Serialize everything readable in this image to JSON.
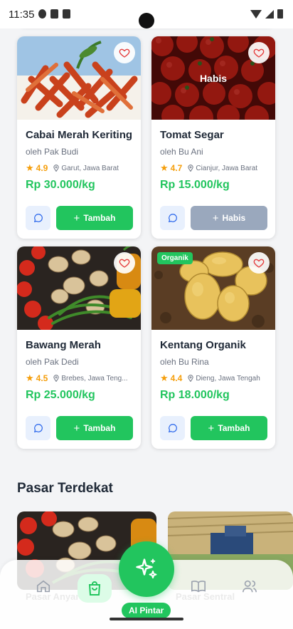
{
  "status_bar": {
    "time": "11:35"
  },
  "products": [
    {
      "name": "Cabai Merah Keriting",
      "seller": "oleh Pak Budi",
      "rating": "4.9",
      "location": "Garut, Jawa Barat",
      "price": "Rp 30.000/kg",
      "action": "Tambah",
      "overlay": "",
      "badge": ""
    },
    {
      "name": "Tomat Segar",
      "seller": "oleh Bu Ani",
      "rating": "4.7",
      "location": "Cianjur, Jawa Barat",
      "price": "Rp 15.000/kg",
      "action": "Habis",
      "overlay": "Habis",
      "badge": ""
    },
    {
      "name": "Bawang Merah",
      "seller": "oleh Pak Dedi",
      "rating": "4.5",
      "location": "Brebes, Jawa Teng...",
      "price": "Rp 25.000/kg",
      "action": "Tambah",
      "overlay": "",
      "badge": ""
    },
    {
      "name": "Kentang Organik",
      "seller": "oleh Bu Rina",
      "rating": "4.4",
      "location": "Dieng, Jawa Tengah",
      "price": "Rp 18.000/kg",
      "action": "Tambah",
      "overlay": "",
      "badge": "Organik"
    }
  ],
  "section": {
    "nearby_title": "Pasar Terdekat"
  },
  "nav": {
    "items": [
      {
        "label": "Pasar Anyar",
        "icon": "home-icon"
      },
      {
        "label": "",
        "icon": "shopping-bag-icon"
      },
      {
        "label": "Pasar Sentral",
        "icon": "book-icon"
      },
      {
        "label": "",
        "icon": "users-icon"
      }
    ],
    "ai_label": "AI Pintar"
  },
  "colors": {
    "accent": "#22c55e",
    "rating": "#f59e0b",
    "disabled": "#9aa8bd"
  }
}
